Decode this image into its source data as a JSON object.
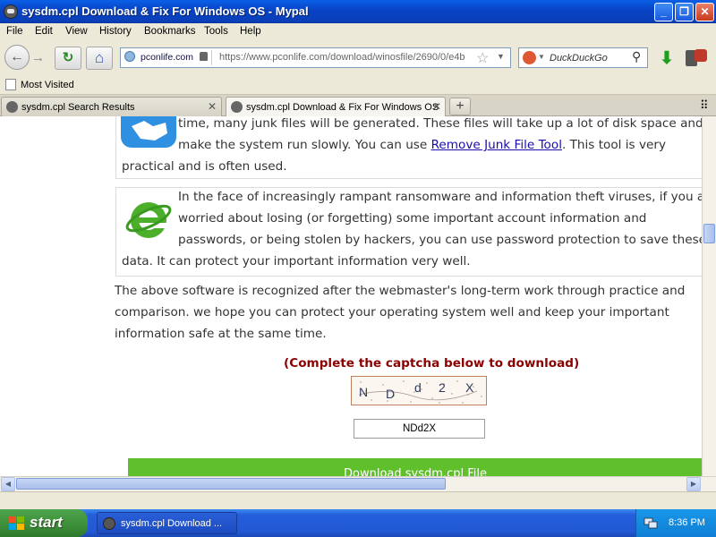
{
  "window": {
    "title": "sysdm.cpl Download & Fix For Windows OS - Mypal",
    "minimize": "_",
    "restore": "❐",
    "close": "✕"
  },
  "menu": [
    "File",
    "Edit",
    "View",
    "History",
    "Bookmarks",
    "Tools",
    "Help"
  ],
  "nav": {
    "back": "←",
    "forward": "→",
    "reload": "↻",
    "home": "⌂",
    "site_identity": "pconlife.com",
    "url": "https://www.pconlife.com/download/winosfile/2690/0/e4b",
    "url_domain": "pconlife.com",
    "search_engine": "DuckDuckGo",
    "search_placeholder": "DuckDuckGo",
    "search_icon": "⚲",
    "star": "☆",
    "url_dropdown": "▼",
    "search_dropdown": "▼",
    "download": "⬇"
  },
  "bookmarks": {
    "most_visited": "Most Visited"
  },
  "tabs": [
    {
      "label": "sysdm.cpl Search Results",
      "close": "✕",
      "active": false
    },
    {
      "label": "sysdm.cpl Download & Fix For Windows OS",
      "close": "✕",
      "active": true
    }
  ],
  "newtab": "+",
  "alltabs": "⠿",
  "content": {
    "card1": {
      "line1": "time, many junk files will be generated. These files will take up a lot of disk space and",
      "line2_pre": "make the system run slowly. You can use ",
      "line2_link": "Remove Junk File Tool",
      "line2_post": ". This tool is very",
      "line3": "practical and is often used."
    },
    "card2": {
      "line1": "In the face of increasingly rampant ransomware and information theft viruses, if you are",
      "line2": "worried about losing (or forgetting) some important account information and",
      "line3": "passwords, or being stolen by hackers, you can use password protection to save these",
      "line4": "data. It can protect your important information very well."
    },
    "para": {
      "line1": "The above software is recognized after the webmaster's long-term work through practice and",
      "line2": "comparison. we hope you can protect your operating system well and keep your important",
      "line3": "information safe at the same time."
    },
    "captcha_title": "(Complete the captcha below to download)",
    "captcha_chars": [
      "N",
      "D",
      "d",
      "2",
      "X"
    ],
    "captcha_value": "NDd2X",
    "download_button": "Download sysdm.cpl File"
  },
  "scroll": {
    "left": "◀",
    "right": "▶"
  },
  "taskbar": {
    "start": "start",
    "item": "sysdm.cpl Download ...",
    "clock": "8:36 PM"
  },
  "colors": {
    "titlebar": "#0842c4",
    "captcha_title": "#8b0000",
    "download_button": "#60c02c",
    "link": "#1a0dab"
  }
}
